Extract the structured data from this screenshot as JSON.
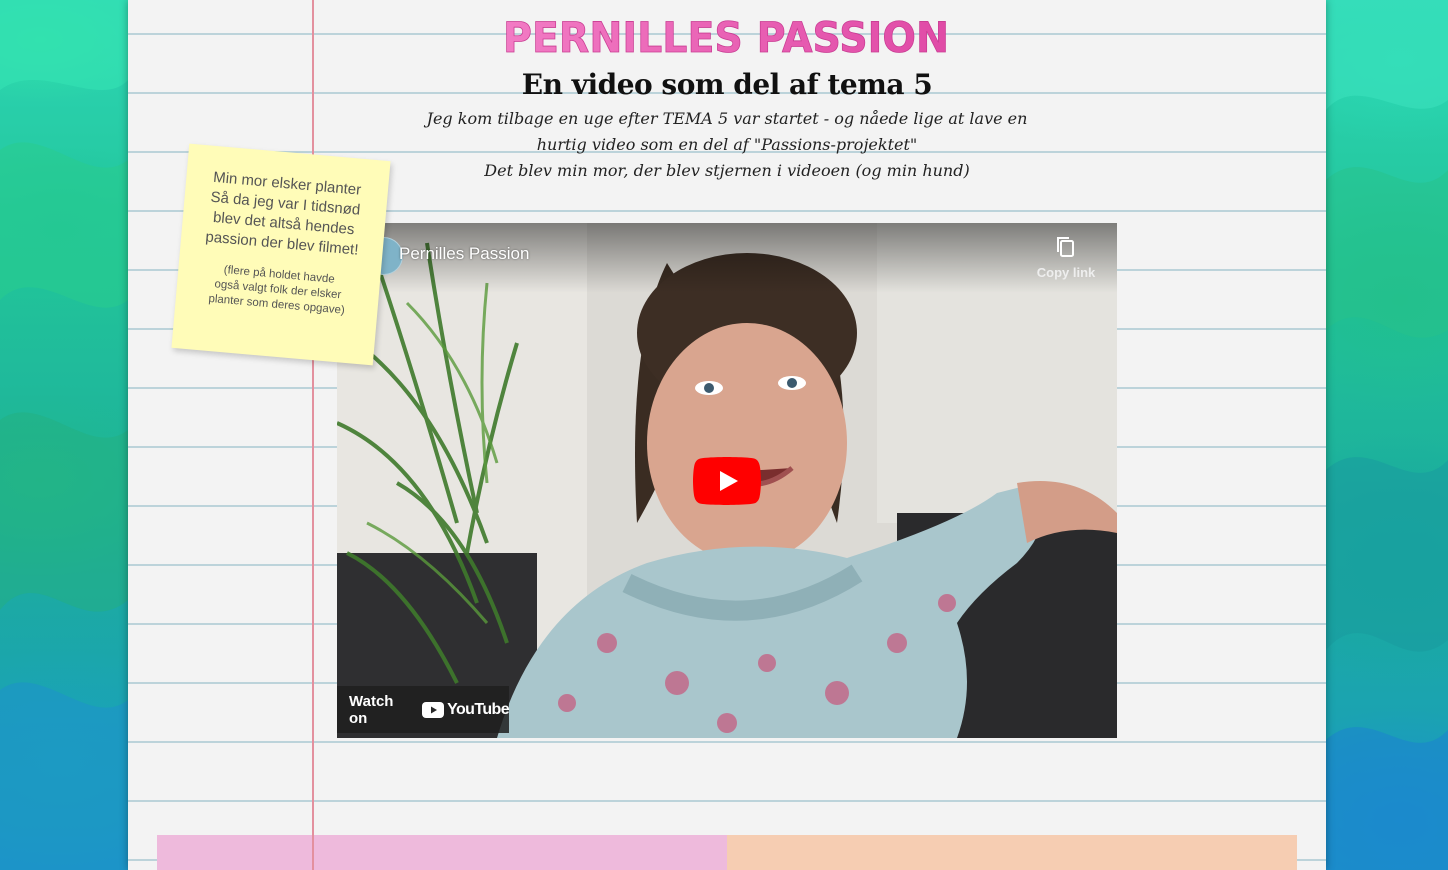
{
  "site": {
    "logo_text": "PERNILLES PASSION"
  },
  "page": {
    "title": "En video som del af tema 5",
    "intro_lines": [
      "Jeg kom tilbage en uge efter TEMA 5 var startet - og nåede lige at lave en",
      "hurtig video som en del af \"Passions-projektet\"",
      "Det blev min mor, der blev stjernen i videoen (og min hund)"
    ]
  },
  "sticky_note": {
    "main_lines": [
      "Min mor elsker planter",
      "Så da jeg var I tidsnød",
      "blev det altså hendes",
      "passion der blev filmet!"
    ],
    "small_lines": [
      "(flere på holdet havde",
      "også valgt folk der elsker",
      "planter som deres opgave)"
    ]
  },
  "video": {
    "title": "Pernilles Passion",
    "copy_link_label": "Copy link",
    "watch_on_label": "Watch on",
    "youtube_label": "YouTube",
    "icons": [
      "copy-icon",
      "play-icon",
      "youtube-logo-icon"
    ]
  },
  "colors": {
    "logo_pink": "#e05ab0",
    "margin_line": "#e3909e",
    "paper": "#f3f3f3",
    "paper_lines": "#bcd3da",
    "sticky": "#fffcb8",
    "youtube_red": "#ff0000",
    "block_pink": "#eebadc",
    "block_peach": "#f6cdb2"
  }
}
